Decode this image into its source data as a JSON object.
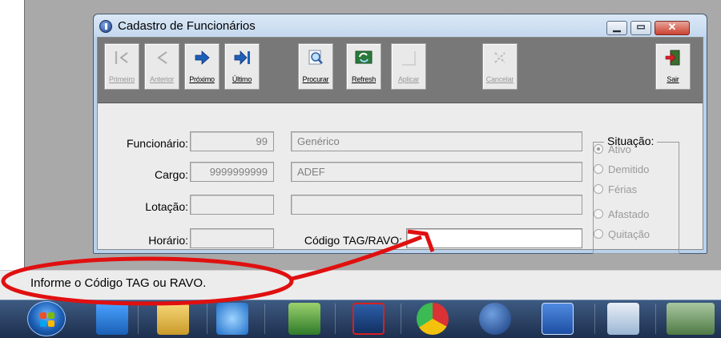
{
  "window": {
    "title": "Cadastro de Funcionários",
    "minimize_icon": "minimize-icon",
    "maximize_icon": "maximize-icon",
    "close_icon": "close-icon"
  },
  "toolbar": {
    "buttons": [
      {
        "label": "Primeiro",
        "icon": "first-record-icon",
        "enabled": false
      },
      {
        "label": "Anterior",
        "icon": "previous-record-icon",
        "enabled": false
      },
      {
        "label": "Próximo",
        "icon": "next-record-icon",
        "enabled": true
      },
      {
        "label": "Último",
        "icon": "last-record-icon",
        "enabled": true
      },
      {
        "label": "Procurar",
        "icon": "search-icon",
        "enabled": true
      },
      {
        "label": "Refresh",
        "icon": "refresh-icon",
        "enabled": true
      },
      {
        "label": "Aplicar",
        "icon": "apply-icon",
        "enabled": false
      },
      {
        "label": "Cancelar",
        "icon": "cancel-icon",
        "enabled": false
      },
      {
        "label": "Sair",
        "icon": "exit-door-icon",
        "enabled": true
      }
    ]
  },
  "form": {
    "funcionario": {
      "label": "Funcionário:",
      "code": "99",
      "name": "Genérico"
    },
    "cargo": {
      "label": "Cargo:",
      "code": "9999999999",
      "name": "ADEF"
    },
    "lotacao": {
      "label": "Lotação:",
      "code": "",
      "name": ""
    },
    "horario": {
      "label": "Horário:",
      "code": ""
    },
    "codigo_tag": {
      "label": "Código TAG/RAVO:",
      "value": ""
    }
  },
  "situacao": {
    "title": "Situação:",
    "options": [
      {
        "label": "Ativo",
        "selected": true
      },
      {
        "label": "Demitido",
        "selected": false
      },
      {
        "label": "Férias",
        "selected": false
      },
      {
        "label": "Afastado",
        "selected": false
      },
      {
        "label": "Quitação",
        "selected": false
      }
    ]
  },
  "status_bar": {
    "text": "Informe o Código TAG ou RAVO."
  },
  "taskbar": {
    "start_icon": "windows-start-icon",
    "apps": [
      "media-player-icon",
      "file-explorer-icon",
      "internet-explorer-icon",
      "network-tool-icon",
      "sql-tools-icon",
      "chrome-icon",
      "app-t-icon",
      "word-icon",
      "network-map-icon",
      "truck-icon"
    ]
  },
  "colors": {
    "annotation": "#e01010",
    "taskbar": "#2b4168",
    "window_frame": "#b9d1ea",
    "toolbar": "#787878"
  }
}
